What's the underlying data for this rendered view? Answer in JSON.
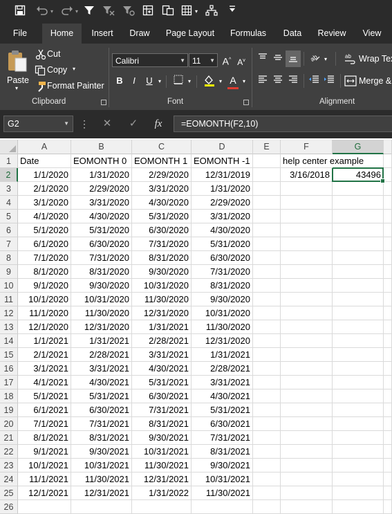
{
  "qat": {
    "icons": [
      "save-icon",
      "undo-icon",
      "redo-icon",
      "filter-icon",
      "clear-filter-icon",
      "reapply-filter-icon",
      "insert-table-icon",
      "copy-format-icon",
      "grid-icon",
      "tree-icon",
      "customize-icon"
    ]
  },
  "tabs": [
    "File",
    "Home",
    "Insert",
    "Draw",
    "Page Layout",
    "Formulas",
    "Data",
    "Review",
    "View"
  ],
  "active_tab": "Home",
  "ribbon": {
    "clipboard": {
      "label": "Clipboard",
      "paste": "Paste",
      "cut": "Cut",
      "copy": "Copy",
      "format_painter": "Format Painter"
    },
    "font": {
      "label": "Font",
      "font_name": "Calibri",
      "font_size": "11",
      "bold": "B",
      "italic": "I",
      "underline": "U",
      "grow": "A",
      "shrink": "A",
      "font_color": "A"
    },
    "alignment": {
      "label": "Alignment",
      "wrap_text": "Wrap Tex",
      "merge": "Merge &"
    }
  },
  "formula_bar": {
    "name_box": "G2",
    "formula": "=EOMONTH(F2,10)",
    "fx": "fx"
  },
  "grid": {
    "columns": [
      "A",
      "B",
      "C",
      "D",
      "E",
      "F",
      "G"
    ],
    "selected_column": "G",
    "selected_row": "2",
    "row_numbers": [
      "1",
      "2",
      "3",
      "4",
      "5",
      "6",
      "7",
      "8",
      "9",
      "10",
      "11",
      "12",
      "13",
      "14",
      "15",
      "16",
      "17",
      "18",
      "19",
      "20",
      "21",
      "22",
      "23",
      "24",
      "25",
      "26"
    ],
    "headers": [
      "Date",
      "EOMONTH 0",
      "EOMONTH 1",
      "EOMONTH -1"
    ],
    "rows": [
      [
        "1/1/2020",
        "1/31/2020",
        "2/29/2020",
        "12/31/2019"
      ],
      [
        "2/1/2020",
        "2/29/2020",
        "3/31/2020",
        "1/31/2020"
      ],
      [
        "3/1/2020",
        "3/31/2020",
        "4/30/2020",
        "2/29/2020"
      ],
      [
        "4/1/2020",
        "4/30/2020",
        "5/31/2020",
        "3/31/2020"
      ],
      [
        "5/1/2020",
        "5/31/2020",
        "6/30/2020",
        "4/30/2020"
      ],
      [
        "6/1/2020",
        "6/30/2020",
        "7/31/2020",
        "5/31/2020"
      ],
      [
        "7/1/2020",
        "7/31/2020",
        "8/31/2020",
        "6/30/2020"
      ],
      [
        "8/1/2020",
        "8/31/2020",
        "9/30/2020",
        "7/31/2020"
      ],
      [
        "9/1/2020",
        "9/30/2020",
        "10/31/2020",
        "8/31/2020"
      ],
      [
        "10/1/2020",
        "10/31/2020",
        "11/30/2020",
        "9/30/2020"
      ],
      [
        "11/1/2020",
        "11/30/2020",
        "12/31/2020",
        "10/31/2020"
      ],
      [
        "12/1/2020",
        "12/31/2020",
        "1/31/2021",
        "11/30/2020"
      ],
      [
        "1/1/2021",
        "1/31/2021",
        "2/28/2021",
        "12/31/2020"
      ],
      [
        "2/1/2021",
        "2/28/2021",
        "3/31/2021",
        "1/31/2021"
      ],
      [
        "3/1/2021",
        "3/31/2021",
        "4/30/2021",
        "2/28/2021"
      ],
      [
        "4/1/2021",
        "4/30/2021",
        "5/31/2021",
        "3/31/2021"
      ],
      [
        "5/1/2021",
        "5/31/2021",
        "6/30/2021",
        "4/30/2021"
      ],
      [
        "6/1/2021",
        "6/30/2021",
        "7/31/2021",
        "5/31/2021"
      ],
      [
        "7/1/2021",
        "7/31/2021",
        "8/31/2021",
        "6/30/2021"
      ],
      [
        "8/1/2021",
        "8/31/2021",
        "9/30/2021",
        "7/31/2021"
      ],
      [
        "9/1/2021",
        "9/30/2021",
        "10/31/2021",
        "8/31/2021"
      ],
      [
        "10/1/2021",
        "10/31/2021",
        "11/30/2021",
        "9/30/2021"
      ],
      [
        "11/1/2021",
        "11/30/2021",
        "12/31/2021",
        "10/31/2021"
      ],
      [
        "12/1/2021",
        "12/31/2021",
        "1/31/2022",
        "11/30/2021"
      ]
    ],
    "help": {
      "label": "help center example",
      "f2": "3/16/2018",
      "g2": "43496"
    }
  },
  "colors": {
    "accent": "#217346",
    "ribbon_bg": "#404040",
    "titlebar_bg": "#2b2b2b"
  }
}
